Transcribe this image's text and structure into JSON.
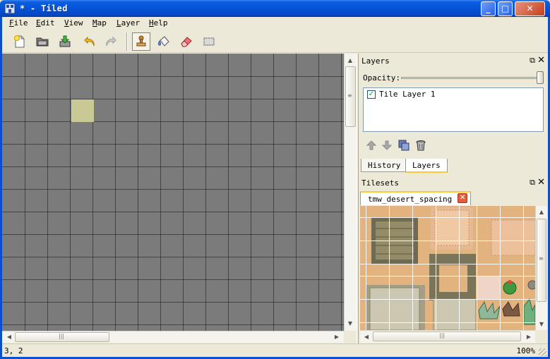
{
  "window": {
    "title": "* - Tiled"
  },
  "menu": [
    {
      "label": "File",
      "u": "F",
      "rest": "ile"
    },
    {
      "label": "Edit",
      "u": "E",
      "rest": "dit"
    },
    {
      "label": "View",
      "u": "V",
      "rest": "iew"
    },
    {
      "label": "Map",
      "u": "M",
      "rest": "ap"
    },
    {
      "label": "Layer",
      "u": "L",
      "rest": "ayer"
    },
    {
      "label": "Help",
      "u": "H",
      "rest": "elp"
    }
  ],
  "toolbar": {
    "buttons": [
      "new-file-icon",
      "open-folder-icon",
      "save-icon",
      "undo-icon",
      "redo-icon",
      "stamp-brush-icon",
      "bucket-fill-icon",
      "eraser-icon",
      "rectangle-select-icon"
    ],
    "active": "stamp-brush-icon"
  },
  "layers_panel": {
    "title": "Layers",
    "opacity_label": "Opacity:",
    "opacity": 1.0,
    "layers": [
      {
        "name": "Tile Layer 1",
        "visible": true
      }
    ],
    "tools": [
      "move-layer-up-icon",
      "move-layer-down-icon",
      "duplicate-layer-icon",
      "delete-layer-icon"
    ]
  },
  "dock_tabs": [
    {
      "label": "History",
      "active": false
    },
    {
      "label": "Layers",
      "active": true
    }
  ],
  "tilesets_panel": {
    "title": "Tilesets",
    "tabs": [
      {
        "label": "tmw_desert_spacing",
        "active": true
      }
    ]
  },
  "status": {
    "coords": "3, 2",
    "zoom": "100%"
  },
  "colors": {
    "titlebar": "#0553d6",
    "map_background": "#7b7b7b",
    "highlight_tile": "#c9c996",
    "tab_accent": "#ffc83c",
    "sand": "#e2b27f"
  }
}
